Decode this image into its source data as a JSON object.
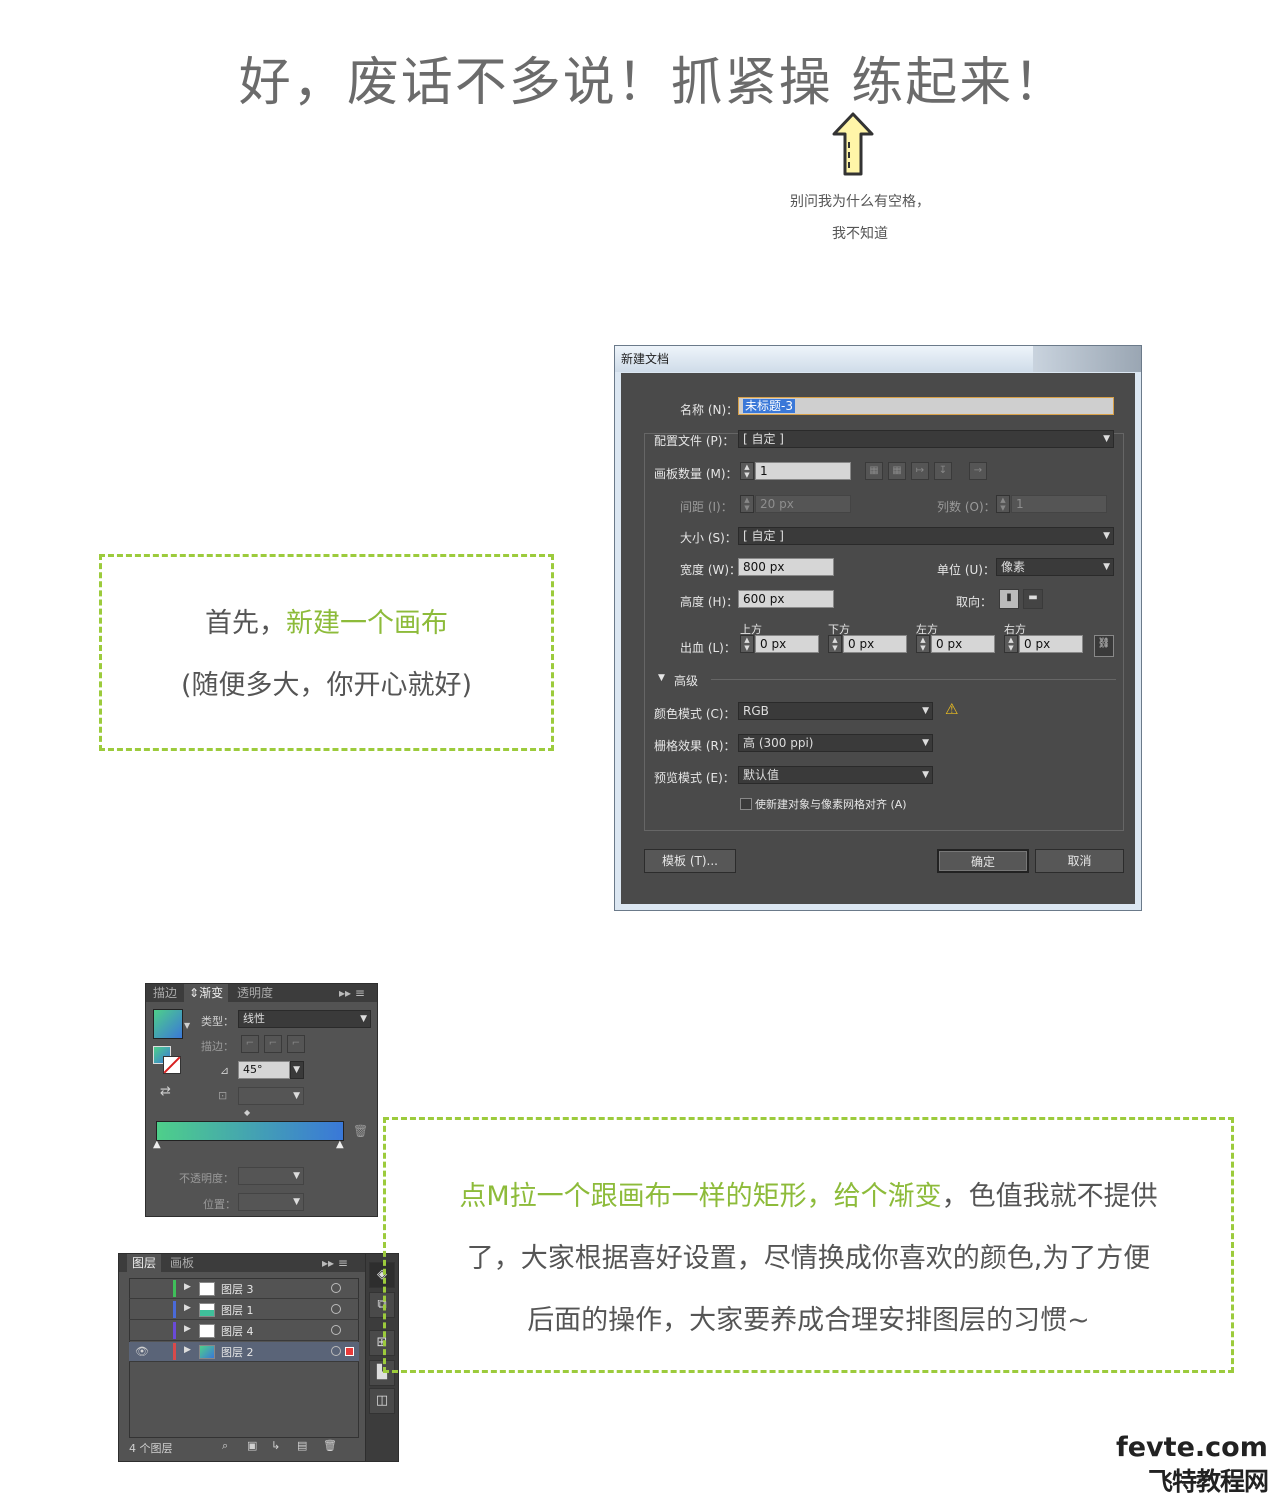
{
  "headline": "好，废话不多说！抓紧操  练起来！",
  "note": {
    "line1": "别问我为什么有空格，",
    "line2": "我不知道"
  },
  "callout1": {
    "intro": "首先，",
    "highlight": "新建一个画布",
    "line2": "(随便多大，你开心就好)"
  },
  "callout2": {
    "highlight": "点M拉一个跟画布一样的矩形，给个渐变",
    "rest1": "，色值我就不提供",
    "line2": "了，大家根据喜好设置，尽情换成你喜欢的颜色,为了方便",
    "line3": "后面的操作，大家要养成合理安排图层的习惯~"
  },
  "dialog": {
    "title": "新建文档",
    "name_label": "名称 (N)：",
    "name_value": "未标题-3",
    "profile_label": "配置文件 (P)：",
    "profile_value": "[ 自定 ]",
    "artboards_label": "画板数量 (M)：",
    "artboards_value": "1",
    "spacing_label": "间距 (I)：",
    "spacing_value": "20 px",
    "columns_label": "列数 (O)：",
    "columns_value": "1",
    "size_label": "大小 (S)：",
    "size_value": "[ 自定 ]",
    "width_label": "宽度 (W)：",
    "width_value": "800 px",
    "units_label": "单位 (U)：",
    "units_value": "像素",
    "height_label": "高度 (H)：",
    "height_value": "600 px",
    "orient_label": "取向：",
    "bleed_label": "出血 (L)：",
    "bleed_top": "上方",
    "bleed_bottom": "下方",
    "bleed_left": "左方",
    "bleed_right": "右方",
    "bleed_value": "0 px",
    "advanced": "高级",
    "color_label": "颜色模式 (C)：",
    "color_value": "RGB",
    "raster_label": "栅格效果 (R)：",
    "raster_value": "高 (300 ppi)",
    "preview_label": "预览模式 (E)：",
    "preview_value": "默认值",
    "align_check": "使新建对象与像素网格对齐 (A)",
    "templates_btn": "模板 (T)...",
    "ok_btn": "确定",
    "cancel_btn": "取消"
  },
  "gradient_panel": {
    "tabs": [
      "描边",
      "渐变",
      "透明度"
    ],
    "type_label": "类型：",
    "type_value": "线性",
    "stroke_label": "描边：",
    "angle_value": "45°",
    "opacity_label": "不透明度：",
    "location_label": "位置："
  },
  "layers_panel": {
    "tabs": [
      "图层",
      "画板"
    ],
    "layers": [
      {
        "name": "图层 3",
        "color": "#3fbf5a"
      },
      {
        "name": "图层 1",
        "color": "#4a6ad8"
      },
      {
        "name": "图层 4",
        "color": "#6a4ad8"
      },
      {
        "name": "图层 2",
        "color": "#d84a4a"
      }
    ],
    "count": "4 个图层"
  },
  "watermark": {
    "line1": "fevte.com",
    "line2": "飞特教程网"
  }
}
